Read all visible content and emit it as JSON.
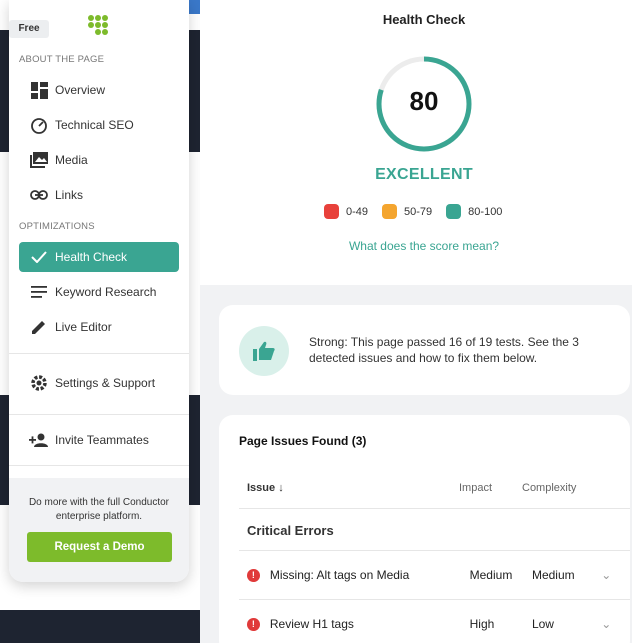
{
  "sidebar": {
    "badge": "Free",
    "about_label": "ABOUT THE PAGE",
    "about_items": [
      {
        "label": "Overview",
        "icon": "dashboard-icon"
      },
      {
        "label": "Technical SEO",
        "icon": "speedometer-icon"
      },
      {
        "label": "Media",
        "icon": "image-icon"
      },
      {
        "label": "Links",
        "icon": "link-icon"
      }
    ],
    "optimizations_label": "OPTIMIZATIONS",
    "optimization_items": [
      {
        "label": "Health Check",
        "icon": "check-icon",
        "active": true
      },
      {
        "label": "Keyword Research",
        "icon": "lines-icon"
      },
      {
        "label": "Live Editor",
        "icon": "pencil-icon"
      }
    ],
    "settings_label": "Settings & Support",
    "invite_label": "Invite Teammates",
    "promo_text": "Do more with the full Conductor enterprise platform.",
    "demo_button": "Request a Demo"
  },
  "health": {
    "title": "Health Check",
    "score": "80",
    "rating": "EXCELLENT",
    "legend": [
      {
        "label": "0-49",
        "color": "#e8413b"
      },
      {
        "label": "50-79",
        "color": "#f4a52f"
      },
      {
        "label": "80-100",
        "color": "#3aa592"
      }
    ],
    "score_link": "What does the score mean?"
  },
  "summary": {
    "text": "Strong: This page passed 16 of 19 tests. See the 3 detected issues and how to fix them below."
  },
  "issues": {
    "title": "Page Issues Found (3)",
    "columns": {
      "issue": "Issue",
      "impact": "Impact",
      "complexity": "Complexity"
    },
    "group": "Critical Errors",
    "rows": [
      {
        "name": "Missing: Alt tags on Media",
        "impact": "Medium",
        "complexity": "Medium"
      },
      {
        "name": "Review H1 tags",
        "impact": "High",
        "complexity": "Low"
      }
    ]
  },
  "colors": {
    "accent": "#3aa592",
    "demo": "#7dbb2b",
    "error": "#e03a3a"
  }
}
